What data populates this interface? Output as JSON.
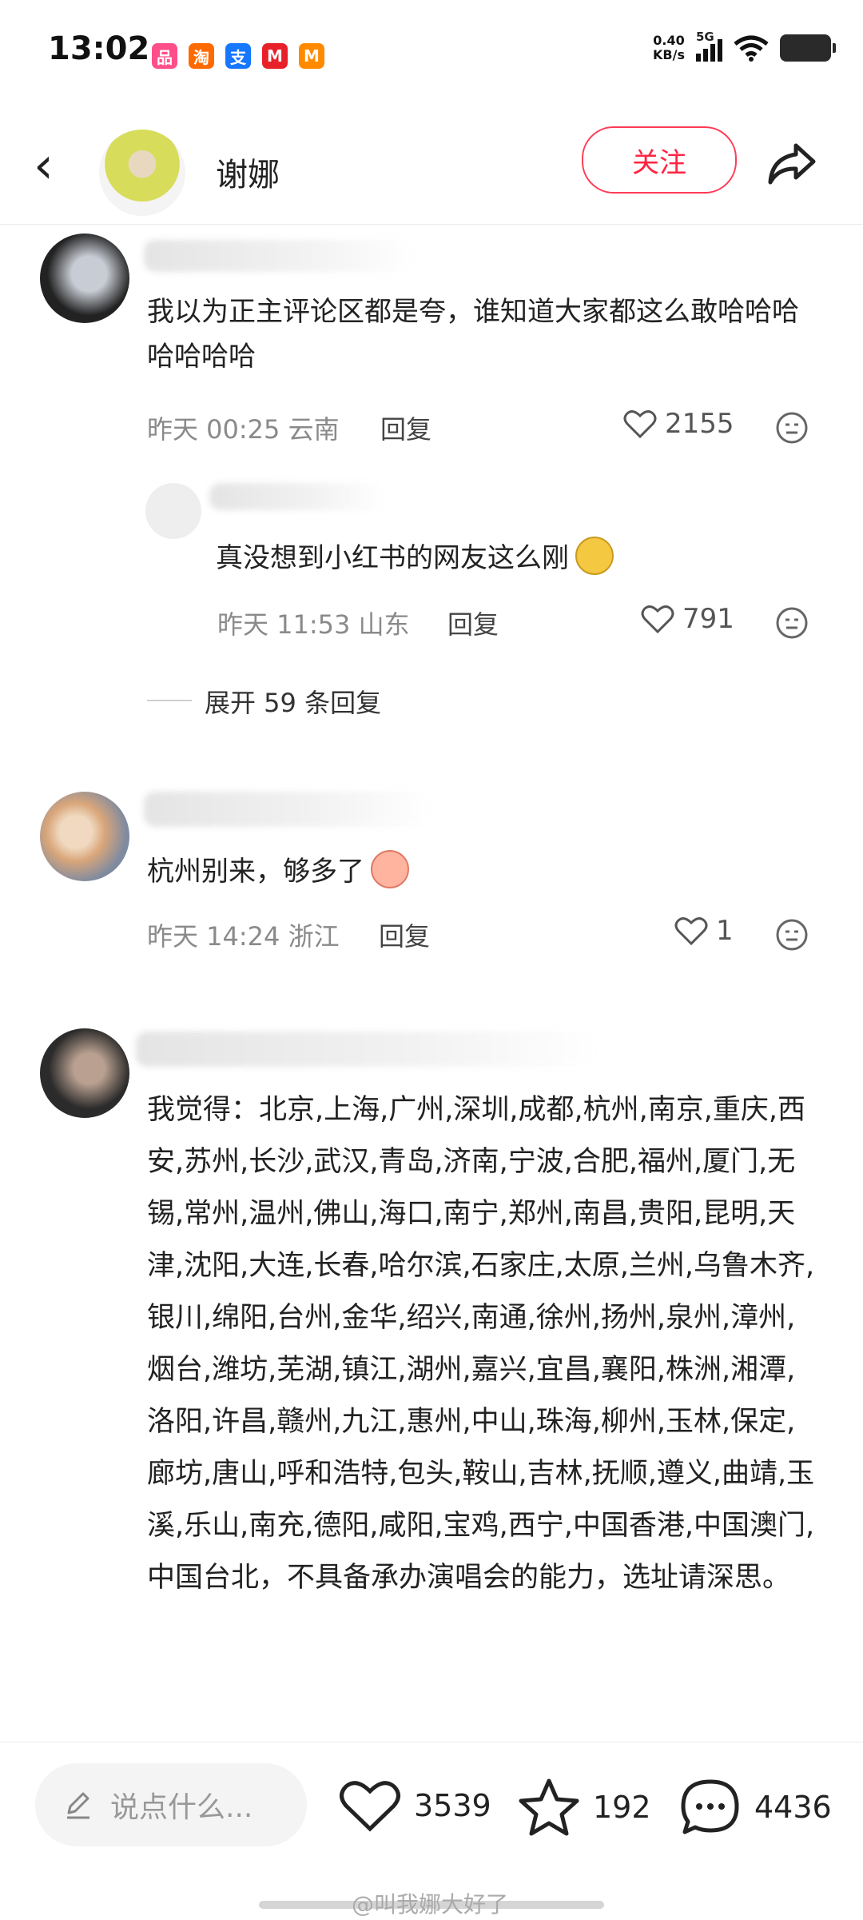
{
  "status_bar": {
    "time": "13:02",
    "apps": [
      "品",
      "淘",
      "支",
      "M",
      "M"
    ],
    "net_speed": "0.40",
    "net_unit": "KB/s",
    "signal": "5G"
  },
  "header": {
    "name": "谢娜",
    "follow_label": "关注"
  },
  "comments": [
    {
      "text": "我以为正主评论区都是夸，谁知道大家都这么敢哈哈哈哈哈哈哈",
      "time": "昨天 00:25 云南",
      "reply": "回复",
      "likes": "2155",
      "sub_reply": {
        "text": "真没想到小红书的网友这么刚",
        "time": "昨天 11:53 山东",
        "reply": "回复",
        "likes": "791"
      },
      "expand": "展开 59 条回复"
    },
    {
      "text": "杭州别来，够多了",
      "time": "昨天 14:24 浙江",
      "reply": "回复",
      "likes": "1"
    },
    {
      "text": "我觉得：北京,上海,广州,深圳,成都,杭州,南京,重庆,西安,苏州,长沙,武汉,青岛,济南,宁波,合肥,福州,厦门,无锡,常州,温州,佛山,海口,南宁,郑州,南昌,贵阳,昆明,天津,沈阳,大连,长春,哈尔滨,石家庄,太原,兰州,乌鲁木齐,银川,绵阳,台州,金华,绍兴,南通,徐州,扬州,泉州,漳州,烟台,潍坊,芜湖,镇江,湖州,嘉兴,宜昌,襄阳,株洲,湘潭,洛阳,许昌,赣州,九江,惠州,中山,珠海,柳州,玉林,保定,廊坊,唐山,呼和浩特,包头,鞍山,吉林,抚顺,遵义,曲靖,玉溪,乐山,南充,德阳,咸阳,宝鸡,西宁,中国香港,中国澳门,中国台北，不具备承办演唱会的能力，选址请深思。"
    }
  ],
  "bottom_bar": {
    "input_placeholder": "说点什么...",
    "likes": "3539",
    "stars": "192",
    "comments": "4436"
  },
  "watermark": "@叫我娜大好了",
  "colors": {
    "accent": "#ff2442"
  }
}
